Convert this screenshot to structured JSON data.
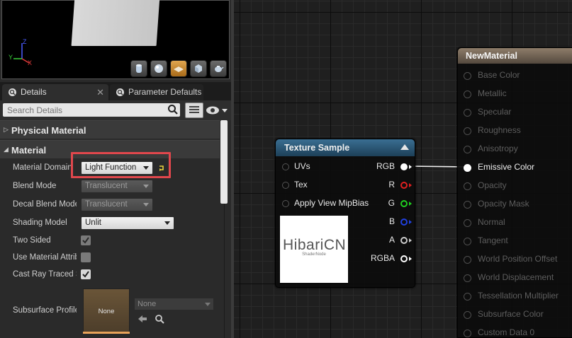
{
  "details_panel": {
    "tabs": [
      {
        "label": "Details",
        "closable": true,
        "icon": "magnifier-icon"
      },
      {
        "label": "Parameter Defaults",
        "icon": "magnifier-icon"
      }
    ],
    "search_placeholder": "Search Details",
    "categories": {
      "physical_material": "Physical Material",
      "material": "Material"
    },
    "properties": {
      "material_domain": {
        "label": "Material Domain",
        "value": "Light Function"
      },
      "blend_mode": {
        "label": "Blend Mode",
        "value": "Translucent"
      },
      "decal_blend_mode": {
        "label": "Decal Blend Mode",
        "value": "Translucent"
      },
      "shading_model": {
        "label": "Shading Model",
        "value": "Unlit"
      },
      "two_sided": {
        "label": "Two Sided",
        "checked": true
      },
      "use_material_attributes": {
        "label": "Use Material Attributes",
        "checked": false
      },
      "cast_ray_traced_shadows": {
        "label": "Cast Ray Traced Shadows",
        "checked": true
      },
      "subsurface_profile": {
        "label": "Subsurface Profile",
        "thumbnail_label": "None",
        "value": "None"
      }
    }
  },
  "viewport": {
    "axis_labels": {
      "z": "Z",
      "y": "Y",
      "x": "X"
    },
    "preview_buttons": [
      "cylinder-icon",
      "sphere-icon",
      "plane-icon",
      "cube-icon",
      "teapot-icon"
    ],
    "active_preview": "plane-icon"
  },
  "graph": {
    "texture_sample": {
      "title": "Texture Sample",
      "inputs": [
        "UVs",
        "Tex",
        "Apply View MipBias"
      ],
      "outputs": [
        {
          "label": "RGB",
          "color": "#ffffff"
        },
        {
          "label": "R",
          "color": "#e02020"
        },
        {
          "label": "G",
          "color": "#20d020"
        },
        {
          "label": "B",
          "color": "#2040e0"
        },
        {
          "label": "A",
          "color": "#cccccc"
        },
        {
          "label": "RGBA",
          "color": "#ffffff"
        }
      ],
      "texture_text": "HibariCN",
      "texture_subtext": "ShaderNode"
    },
    "new_material": {
      "title": "NewMaterial",
      "inputs": [
        {
          "label": "Base Color",
          "active": false
        },
        {
          "label": "Metallic",
          "active": false
        },
        {
          "label": "Specular",
          "active": false
        },
        {
          "label": "Roughness",
          "active": false
        },
        {
          "label": "Anisotropy",
          "active": false
        },
        {
          "label": "Emissive Color",
          "active": true
        },
        {
          "label": "Opacity",
          "active": false
        },
        {
          "label": "Opacity Mask",
          "active": false
        },
        {
          "label": "Normal",
          "active": false
        },
        {
          "label": "Tangent",
          "active": false
        },
        {
          "label": "World Position Offset",
          "active": false
        },
        {
          "label": "World Displacement",
          "active": false
        },
        {
          "label": "Tessellation Multiplier",
          "active": false
        },
        {
          "label": "Subsurface Color",
          "active": false
        },
        {
          "label": "Custom Data 0",
          "active": false
        }
      ]
    }
  },
  "colors": {
    "highlight": "#e0474c",
    "texture_header": "#2b5674",
    "material_header": "#7a6b5a",
    "active_pin": "#ffffff"
  }
}
